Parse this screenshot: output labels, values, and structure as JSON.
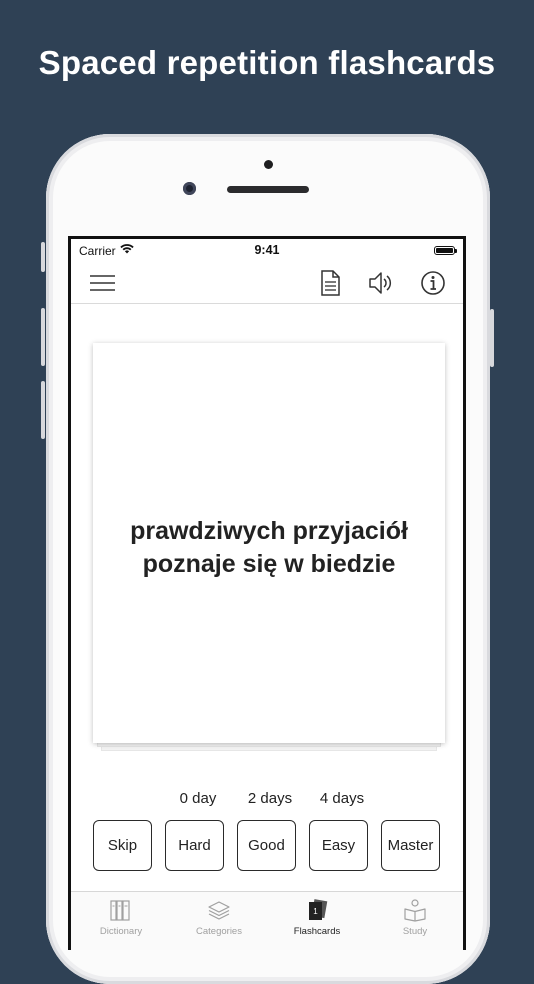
{
  "headline": "Spaced repetition flashcards",
  "status_bar": {
    "carrier": "Carrier",
    "time": "9:41"
  },
  "navbar": {
    "icons": [
      "menu-icon",
      "document-icon",
      "speaker-icon",
      "info-icon"
    ]
  },
  "card": {
    "line1": "prawdziwych przyjaciół",
    "line2": "poznaje się w biedzie"
  },
  "intervals": [
    "0 day",
    "2 days",
    "4 days"
  ],
  "buttons": {
    "skip": "Skip",
    "hard": "Hard",
    "good": "Good",
    "easy": "Easy",
    "master": "Master"
  },
  "tabs": [
    {
      "label": "Dictionary",
      "icon": "books-icon"
    },
    {
      "label": "Categories",
      "icon": "layers-icon"
    },
    {
      "label": "Flashcards",
      "icon": "cards-icon",
      "badge": "1",
      "active": true
    },
    {
      "label": "Study",
      "icon": "book-reader-icon"
    }
  ],
  "colors": {
    "background": "#2f4155",
    "headline": "#ffffff",
    "active_tab": "#222222",
    "inactive_tab": "#a0a0a0"
  }
}
